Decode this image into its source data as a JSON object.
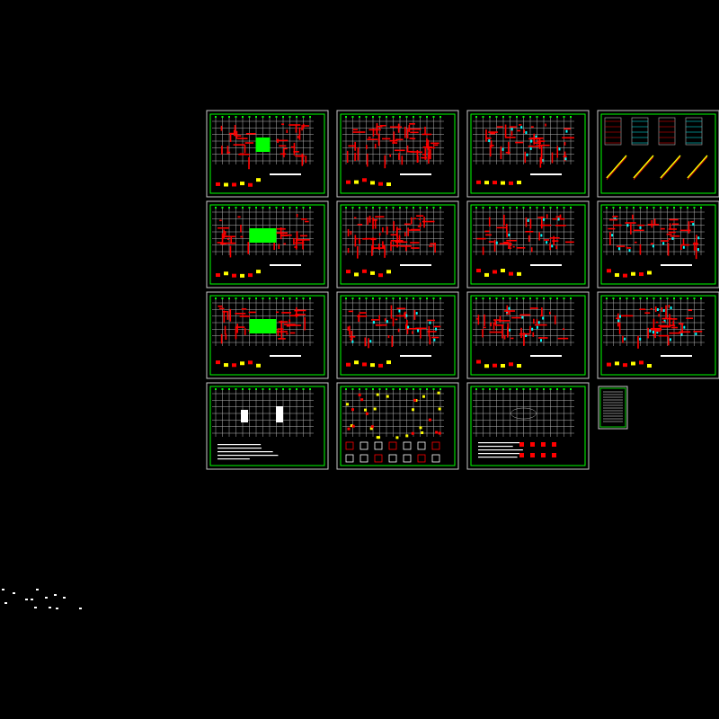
{
  "drawing": {
    "background": "#000000",
    "colors": {
      "sheet_frame": "#c8c8c8",
      "sheet_border": "#00ff00",
      "grid": "#b4b4b4",
      "members": "#ff0000",
      "slab": "#00ff00",
      "annotation": "#00ffff",
      "detail": "#ffff00",
      "text": "#ffffff"
    },
    "sheets": [
      {
        "kind": "plan-red-green-center"
      },
      {
        "kind": "plan-red-dense"
      },
      {
        "kind": "plan-red-cyan"
      },
      {
        "kind": "stair-details"
      },
      {
        "kind": "plan-red-green-center"
      },
      {
        "kind": "plan-red-dense"
      },
      {
        "kind": "plan-red-cyan"
      },
      {
        "kind": "plan-red-cyan"
      },
      {
        "kind": "plan-red-green-details"
      },
      {
        "kind": "plan-red-cyan"
      },
      {
        "kind": "plan-red-cyan"
      },
      {
        "kind": "plan-red-cyan"
      },
      {
        "kind": "foundation-plan"
      },
      {
        "kind": "column-yellow-details"
      },
      {
        "kind": "plan-grid-only"
      }
    ],
    "index_table": {
      "kind": "drawing-list"
    }
  }
}
